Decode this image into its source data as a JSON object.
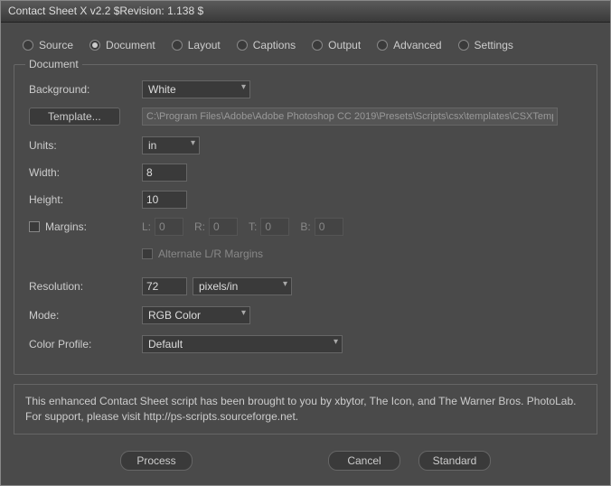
{
  "titlebar": "Contact Sheet X v2.2 $Revision: 1.138 $",
  "tabs": {
    "source": "Source",
    "document": "Document",
    "layout": "Layout",
    "captions": "Captions",
    "output": "Output",
    "advanced": "Advanced",
    "settings": "Settings"
  },
  "group": {
    "title": "Document"
  },
  "fields": {
    "background_label": "Background:",
    "background_value": "White",
    "template_btn": "Template...",
    "template_path": "C:\\Program Files\\Adobe\\Adobe Photoshop CC 2019\\Presets\\Scripts\\csx\\templates\\CSXTemplate-D",
    "units_label": "Units:",
    "units_value": "in",
    "width_label": "Width:",
    "width_value": "8",
    "height_label": "Height:",
    "height_value": "10",
    "margins_label": "Margins:",
    "margin_L": "L:",
    "margin_L_val": "0",
    "margin_R": "R:",
    "margin_R_val": "0",
    "margin_T": "T:",
    "margin_T_val": "0",
    "margin_B": "B:",
    "margin_B_val": "0",
    "alternate_label": "Alternate L/R Margins",
    "resolution_label": "Resolution:",
    "resolution_value": "72",
    "resolution_unit": "pixels/in",
    "mode_label": "Mode:",
    "mode_value": "RGB Color",
    "colorprofile_label": "Color Profile:",
    "colorprofile_value": "Default"
  },
  "footer": "This enhanced Contact Sheet script has been brought to you by xbytor, The Icon, and The Warner Bros. PhotoLab. For support, please visit http://ps-scripts.sourceforge.net.",
  "actions": {
    "process": "Process",
    "cancel": "Cancel",
    "standard": "Standard"
  }
}
